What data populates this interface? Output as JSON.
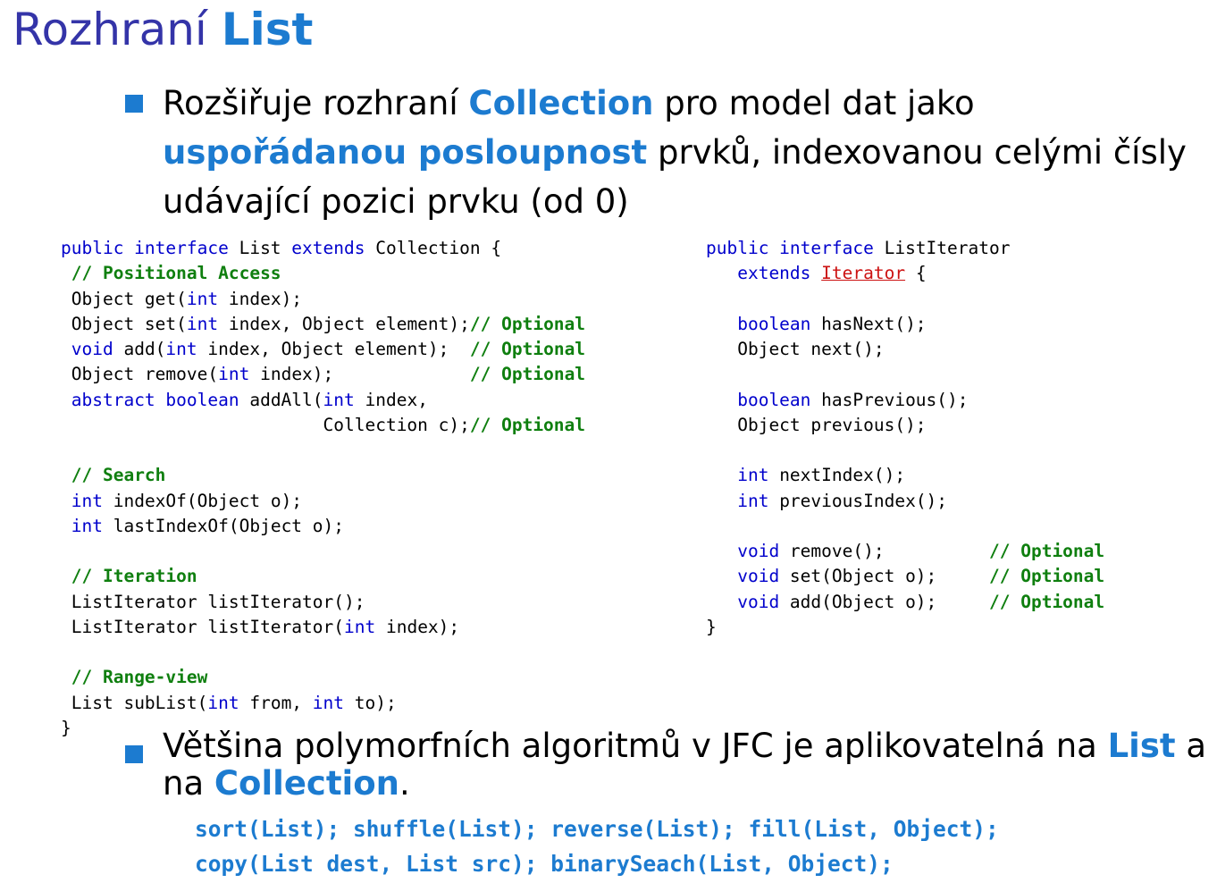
{
  "slide": {
    "title_prefix": "Rozhraní",
    "title_highlight": "List"
  },
  "bullet1": {
    "t1": "Rozšiřuje rozhraní ",
    "h1": "Collection",
    "t2": " pro model dat jako",
    "h2": "uspořádanou posloupnost",
    "t3": " prvků, indexovanou celými čísly",
    "t4": "udávající pozici prvku (od 0)"
  },
  "list_code": {
    "l1": {
      "a": "public interface",
      "b": " List ",
      "c": "extends",
      "d": " Collection {"
    },
    "l2": {
      "a": "// Positional Access"
    },
    "l3": {
      "a": "Object get(",
      "b": "int",
      "c": " index);"
    },
    "l4": {
      "a": "Object set(",
      "b": "int",
      "c": " index, Object element);",
      "d": "// Optional"
    },
    "l5": {
      "a": "void",
      "b": " add(",
      "c": "int",
      "d": " index, Object element);  ",
      "e": "// Optional"
    },
    "l6": {
      "a": "Object remove(",
      "b": "int",
      "c": " index);             ",
      "d": "// Optional"
    },
    "l7": {
      "a": "abstract boolean",
      "b": " addAll(",
      "c": "int",
      "d": " index,"
    },
    "l8": {
      "a": "                        Collection c);",
      "b": "// Optional"
    },
    "l9": {
      "a": "// Search"
    },
    "l10": {
      "a": "int",
      "b": " indexOf(Object o);"
    },
    "l11": {
      "a": "int",
      "b": " lastIndexOf(Object o);"
    },
    "l12": {
      "a": "// Iteration"
    },
    "l13": {
      "a": "ListIterator listIterator();"
    },
    "l14": {
      "a": "ListIterator listIterator(",
      "b": "int",
      "c": " index);"
    },
    "l15": {
      "a": "// Range-view"
    },
    "l16": {
      "a": "List subList(",
      "b": "int",
      "c": " from, ",
      "d": "int",
      "e": " to);"
    },
    "l17": {
      "a": "}"
    }
  },
  "iter_code": {
    "l1": {
      "a": "public interface",
      "b": " ListIterator"
    },
    "l2": {
      "a": "   extends",
      "b": " ",
      "c": "Iterator",
      "d": " {"
    },
    "l3": {
      "a": "   boolean",
      "b": " hasNext();"
    },
    "l4": {
      "a": "   Object next();"
    },
    "l5": {
      "a": "   boolean",
      "b": " hasPrevious();"
    },
    "l6": {
      "a": "   Object previous();"
    },
    "l7": {
      "a": "   int",
      "b": " nextIndex();"
    },
    "l8": {
      "a": "   int",
      "b": " previousIndex();"
    },
    "l9": {
      "a": "   void",
      "b": " remove();          ",
      "c": "// Optional"
    },
    "l10": {
      "a": "   void",
      "b": " set(Object o);     ",
      "c": "// Optional"
    },
    "l11": {
      "a": "   void",
      "b": " add(Object o);     ",
      "c": "// Optional"
    },
    "l12": {
      "a": "}"
    }
  },
  "bullet2": {
    "t1": "Většina polymorfních algoritmů v JFC je aplikovatelná na ",
    "h1": "List",
    "t2": " a ne",
    "t3": "na ",
    "h2": "Collection",
    "t4": "."
  },
  "calls": {
    "line1": "sort(List); shuffle(List); reverse(List); fill(List, Object);",
    "line2": "copy(List dest, List src); binarySeach(List, Object);"
  }
}
